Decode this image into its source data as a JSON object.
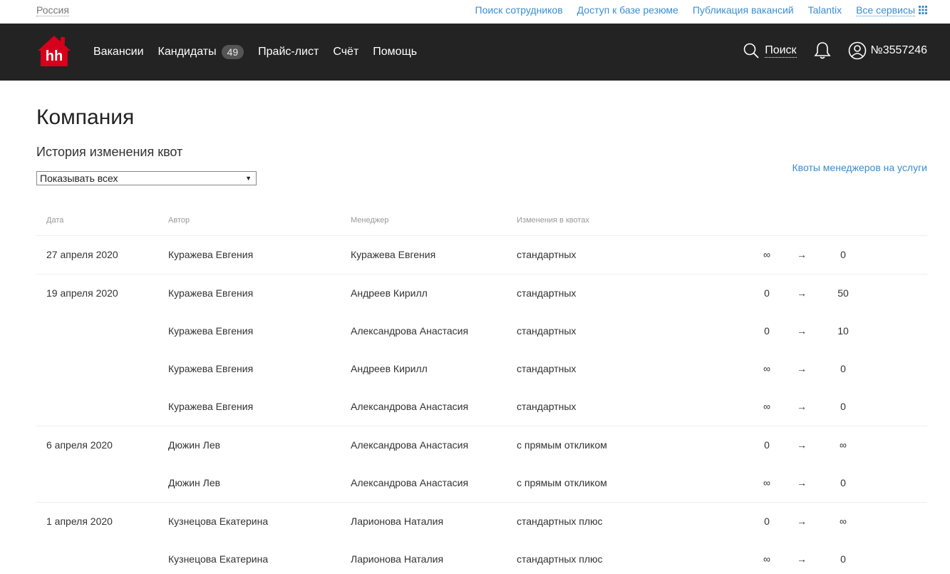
{
  "topbar": {
    "region": "Россия",
    "links": [
      "Поиск сотрудников",
      "Доступ к базе резюме",
      "Публикация вакансий",
      "Talantix"
    ],
    "all_services": "Все сервисы"
  },
  "header": {
    "logo_text": "hh",
    "nav": [
      {
        "label": "Вакансии"
      },
      {
        "label": "Кандидаты",
        "badge": "49"
      },
      {
        "label": "Прайс-лист"
      },
      {
        "label": "Счёт"
      },
      {
        "label": "Помощь"
      }
    ],
    "search_label": "Поиск",
    "account_number": "№3557246"
  },
  "page": {
    "title": "Компания",
    "section_title": "История изменения квот",
    "filter_value": "Показывать всех",
    "quota_link": "Квоты менеджеров на услуги"
  },
  "table": {
    "headers": {
      "date": "Дата",
      "author": "Автор",
      "manager": "Менеджер",
      "quota": "Изменения в квотах"
    },
    "arrow": "→",
    "groups": [
      {
        "date": "27 апреля 2020",
        "rows": [
          {
            "author": "Куражева Евгения",
            "manager": "Куражева Евгения",
            "quota": "стандартных",
            "from": "∞",
            "to": "0"
          }
        ]
      },
      {
        "date": "19 апреля 2020",
        "rows": [
          {
            "author": "Куражева Евгения",
            "manager": "Андреев Кирилл",
            "quota": "стандартных",
            "from": "0",
            "to": "50"
          },
          {
            "author": "Куражева Евгения",
            "manager": "Александрова Анастасия",
            "quota": "стандартных",
            "from": "0",
            "to": "10"
          },
          {
            "author": "Куражева Евгения",
            "manager": "Андреев Кирилл",
            "quota": "стандартных",
            "from": "∞",
            "to": "0"
          },
          {
            "author": "Куражева Евгения",
            "manager": "Александрова Анастасия",
            "quota": "стандартных",
            "from": "∞",
            "to": "0"
          }
        ]
      },
      {
        "date": "6 апреля 2020",
        "rows": [
          {
            "author": "Дюжин Лев",
            "manager": "Александрова Анастасия",
            "quota": "с прямым откликом",
            "from": "0",
            "to": "∞"
          },
          {
            "author": "Дюжин Лев",
            "manager": "Александрова Анастасия",
            "quota": "с прямым откликом",
            "from": "∞",
            "to": "0"
          }
        ]
      },
      {
        "date": "1 апреля 2020",
        "rows": [
          {
            "author": "Кузнецова Екатерина",
            "manager": "Ларионова Наталия",
            "quota": "стандартных плюс",
            "from": "0",
            "to": "∞"
          },
          {
            "author": "Кузнецова Екатерина",
            "manager": "Ларионова Наталия",
            "quota": "стандартных плюс",
            "from": "∞",
            "to": "0"
          }
        ]
      }
    ]
  },
  "colors": {
    "header_bg": "#232323",
    "link": "#3b8ed0",
    "logo_red": "#d6001c"
  }
}
